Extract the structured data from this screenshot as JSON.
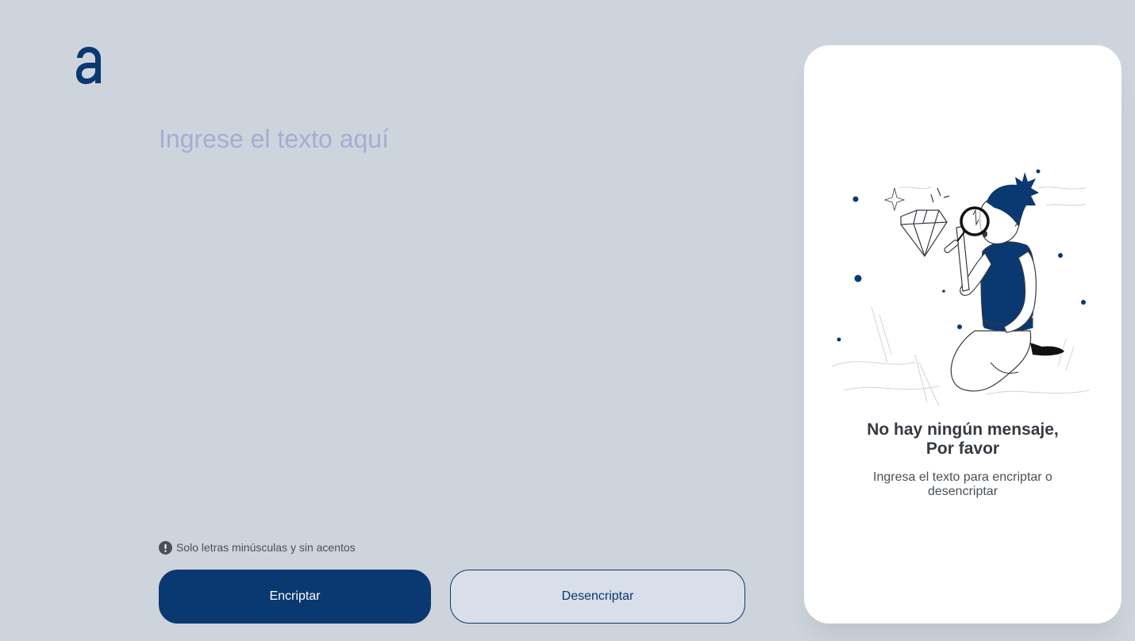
{
  "brand": {
    "logo_icon": "alura-a-logo-icon",
    "accent": "#0a3871"
  },
  "editor": {
    "placeholder": "Ingrese el texto aquí",
    "value": ""
  },
  "hint": {
    "icon": "exclamation-circle-icon",
    "text": "Solo letras minúsculas y sin acentos"
  },
  "actions": {
    "encrypt_label": "Encriptar",
    "decrypt_label": "Desencriptar"
  },
  "result_panel": {
    "illustration": "boy-with-magnifying-glass-illustration",
    "title_line1": "No hay ningún mensaje,",
    "title_line2": "Por favor",
    "subtitle": "Ingresa el texto para encriptar o desencriptar"
  }
}
